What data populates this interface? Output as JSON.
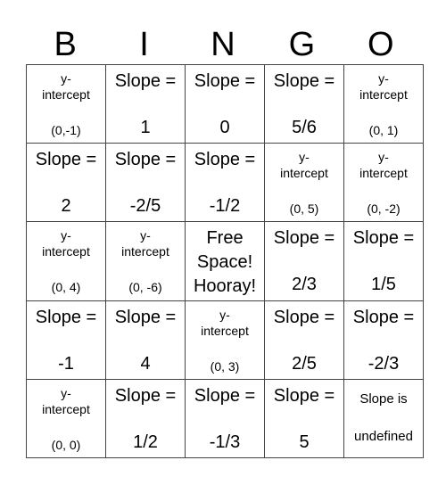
{
  "header": [
    "B",
    "I",
    "N",
    "G",
    "O"
  ],
  "rows": [
    [
      {
        "type": "yint",
        "lines": [
          "y-",
          "intercept",
          "(0,-1)"
        ]
      },
      {
        "type": "slope",
        "lines": [
          "Slope =",
          "1"
        ]
      },
      {
        "type": "slope",
        "lines": [
          "Slope =",
          "0"
        ]
      },
      {
        "type": "slope",
        "lines": [
          "Slope =",
          "5/6"
        ]
      },
      {
        "type": "yint",
        "lines": [
          "y-",
          "intercept",
          "(0, 1)"
        ]
      }
    ],
    [
      {
        "type": "slope",
        "lines": [
          "Slope =",
          "2"
        ]
      },
      {
        "type": "slope",
        "lines": [
          "Slope =",
          "-2/5"
        ]
      },
      {
        "type": "slope",
        "lines": [
          "Slope =",
          "-1/2"
        ]
      },
      {
        "type": "yint",
        "lines": [
          "y-",
          "intercept",
          "(0, 5)"
        ]
      },
      {
        "type": "yint",
        "lines": [
          "y-",
          "intercept",
          "(0, -2)"
        ]
      }
    ],
    [
      {
        "type": "yint",
        "lines": [
          "y-",
          "intercept",
          "(0, 4)"
        ]
      },
      {
        "type": "yint",
        "lines": [
          "y-",
          "intercept",
          "(0, -6)"
        ]
      },
      {
        "type": "free",
        "lines": [
          "Free",
          "Space!",
          "Hooray!"
        ]
      },
      {
        "type": "slope",
        "lines": [
          "Slope =",
          "2/3"
        ]
      },
      {
        "type": "slope",
        "lines": [
          "Slope =",
          "1/5"
        ]
      }
    ],
    [
      {
        "type": "slope",
        "lines": [
          "Slope =",
          "-1"
        ]
      },
      {
        "type": "slope",
        "lines": [
          "Slope =",
          "4"
        ]
      },
      {
        "type": "yint",
        "lines": [
          "y-",
          "intercept",
          "(0, 3)"
        ]
      },
      {
        "type": "slope",
        "lines": [
          "Slope =",
          "2/5"
        ]
      },
      {
        "type": "slope",
        "lines": [
          "Slope =",
          "-2/3"
        ]
      }
    ],
    [
      {
        "type": "yint",
        "lines": [
          "y-",
          "intercept",
          "(0, 0)"
        ]
      },
      {
        "type": "slope",
        "lines": [
          "Slope =",
          "1/2"
        ]
      },
      {
        "type": "slope",
        "lines": [
          "Slope =",
          "-1/3"
        ]
      },
      {
        "type": "slope",
        "lines": [
          "Slope =",
          "5"
        ]
      },
      {
        "type": "undef",
        "lines": [
          "Slope is",
          "undefined"
        ]
      }
    ]
  ]
}
